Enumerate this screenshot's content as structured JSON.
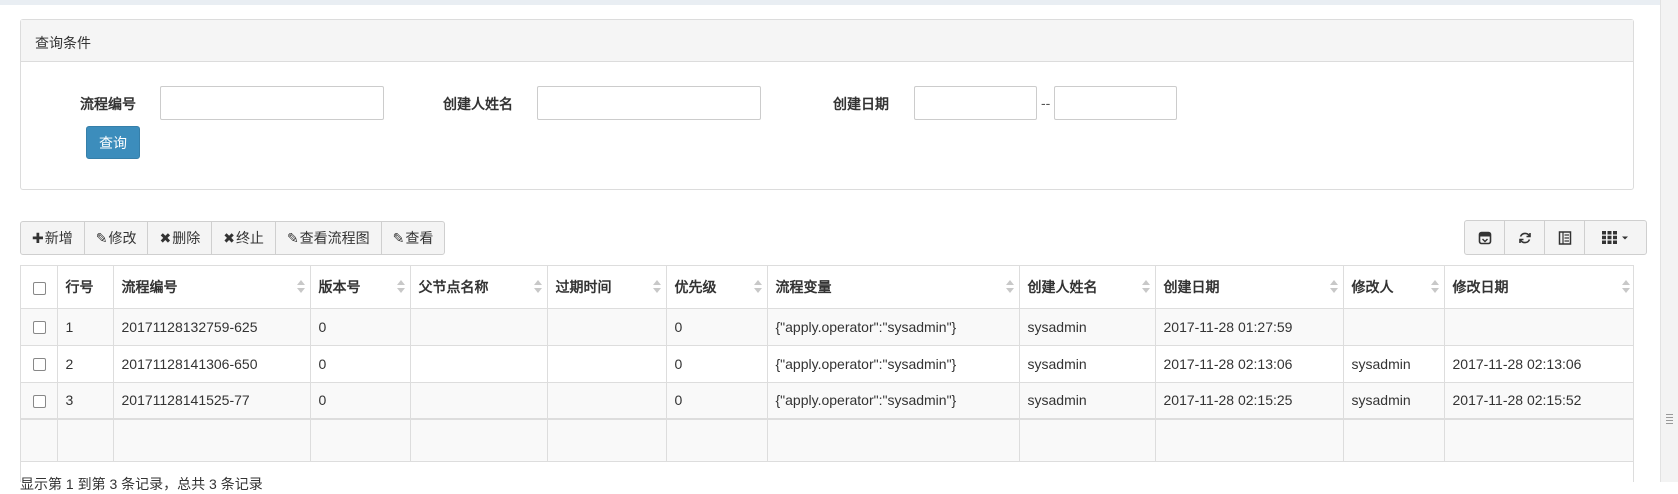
{
  "query_panel": {
    "title": "查询条件",
    "process_no_label": "流程编号",
    "process_no_value": "",
    "creator_label": "创建人姓名",
    "creator_value": "",
    "create_date_label": "创建日期",
    "date_from_value": "",
    "date_to_value": "",
    "date_separator": "--",
    "query_button": "查询"
  },
  "toolbar": {
    "add": "新增",
    "edit": "修改",
    "delete": "删除",
    "terminate": "终止",
    "view_flowchart": "查看流程图",
    "view": "查看"
  },
  "right_tools": {
    "icons": [
      "toggle-icon",
      "refresh-icon",
      "columns-list-icon",
      "grid-icon"
    ]
  },
  "table": {
    "headers": [
      "行号",
      "流程编号",
      "版本号",
      "父节点名称",
      "过期时间",
      "优先级",
      "流程变量",
      "创建人姓名",
      "创建日期",
      "修改人",
      "修改日期"
    ],
    "rows": [
      [
        "1",
        "20171128132759-625",
        "0",
        "",
        "",
        "0",
        "{\"apply.operator\":\"sysadmin\"}",
        "sysadmin",
        "2017-11-28 01:27:59",
        "",
        ""
      ],
      [
        "2",
        "20171128141306-650",
        "0",
        "",
        "",
        "0",
        "{\"apply.operator\":\"sysadmin\"}",
        "sysadmin",
        "2017-11-28 02:13:06",
        "sysadmin",
        "2017-11-28 02:13:06"
      ],
      [
        "3",
        "20171128141525-77",
        "0",
        "",
        "",
        "0",
        "{\"apply.operator\":\"sysadmin\"}",
        "sysadmin",
        "2017-11-28 02:15:25",
        "sysadmin",
        "2017-11-28 02:15:52"
      ]
    ]
  },
  "pager": {
    "summary": "显示第 1 到第 3 条记录，总共 3 条记录"
  },
  "colors": {
    "primary_button": "#3c8dbc",
    "panel_header": "#f5f5f5",
    "row_stripe": "#f9f9f9"
  }
}
